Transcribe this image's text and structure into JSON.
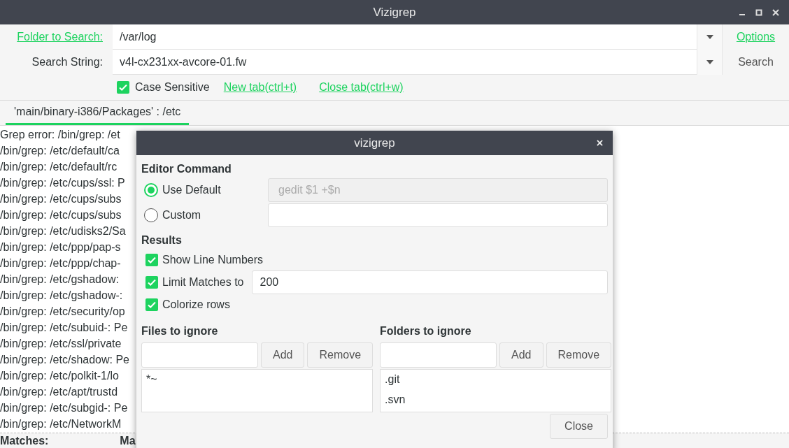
{
  "window": {
    "title": "Vizigrep"
  },
  "form": {
    "folder_label": "Folder to Search:",
    "folder_value": "/var/log",
    "options_link": "Options",
    "search_label": "Search String:",
    "search_value": "v4l-cx231xx-avcore-01.fw",
    "search_button": "Search",
    "case_sensitive": {
      "label": "Case Sensitive",
      "checked": true
    },
    "new_tab": "New tab(ctrl+t)",
    "close_tab": "Close tab(ctrl+w)"
  },
  "tabs": [
    {
      "label": "'main/binary-i386/Packages' : /etc",
      "selected": true
    }
  ],
  "output": {
    "lines": [
      "Grep error: /bin/grep: /et",
      "/bin/grep: /etc/default/ca",
      "/bin/grep: /etc/default/rc",
      "/bin/grep: /etc/cups/ssl: P",
      "/bin/grep: /etc/cups/subs",
      "/bin/grep: /etc/cups/subs",
      "/bin/grep: /etc/udisks2/Sa",
      "/bin/grep: /etc/ppp/pap-s",
      "/bin/grep: /etc/ppp/chap-",
      "/bin/grep: /etc/gshadow:",
      "/bin/grep: /etc/gshadow-:",
      "/bin/grep: /etc/security/op",
      "/bin/grep: /etc/subuid-: Pe",
      "/bin/grep: /etc/ssl/private",
      "/bin/grep: /etc/shadow: Pe",
      "/bin/grep: /etc/polkit-1/lo",
      "/bin/grep: /etc/apt/trustd",
      "/bin/grep: /etc/subgid-: Pe",
      "/bin/grep: /etc/NetworkM"
    ]
  },
  "status_bar": [
    "Matches:",
    "Ma"
  ],
  "dialog": {
    "title": "vizigrep",
    "editor_heading": "Editor Command",
    "editor_options": [
      {
        "label": "Use Default",
        "selected": true,
        "value": "gedit $1 +$n",
        "disabled": true
      },
      {
        "label": "Custom",
        "selected": false,
        "disabled": false
      }
    ],
    "results_heading": "Results",
    "results": [
      {
        "label": "Show Line Numbers",
        "checked": true
      },
      {
        "label": "Limit Matches to",
        "checked": true,
        "value": "200"
      },
      {
        "label": "Colorize rows",
        "checked": true
      }
    ],
    "ignore_lists": [
      {
        "heading": "Files to ignore",
        "add": "Add",
        "remove": "Remove",
        "items": [
          "*~"
        ]
      },
      {
        "heading": "Folders to ignore",
        "add": "Add",
        "remove": "Remove",
        "items": [
          ".git",
          ".svn"
        ]
      }
    ],
    "close": "Close"
  }
}
